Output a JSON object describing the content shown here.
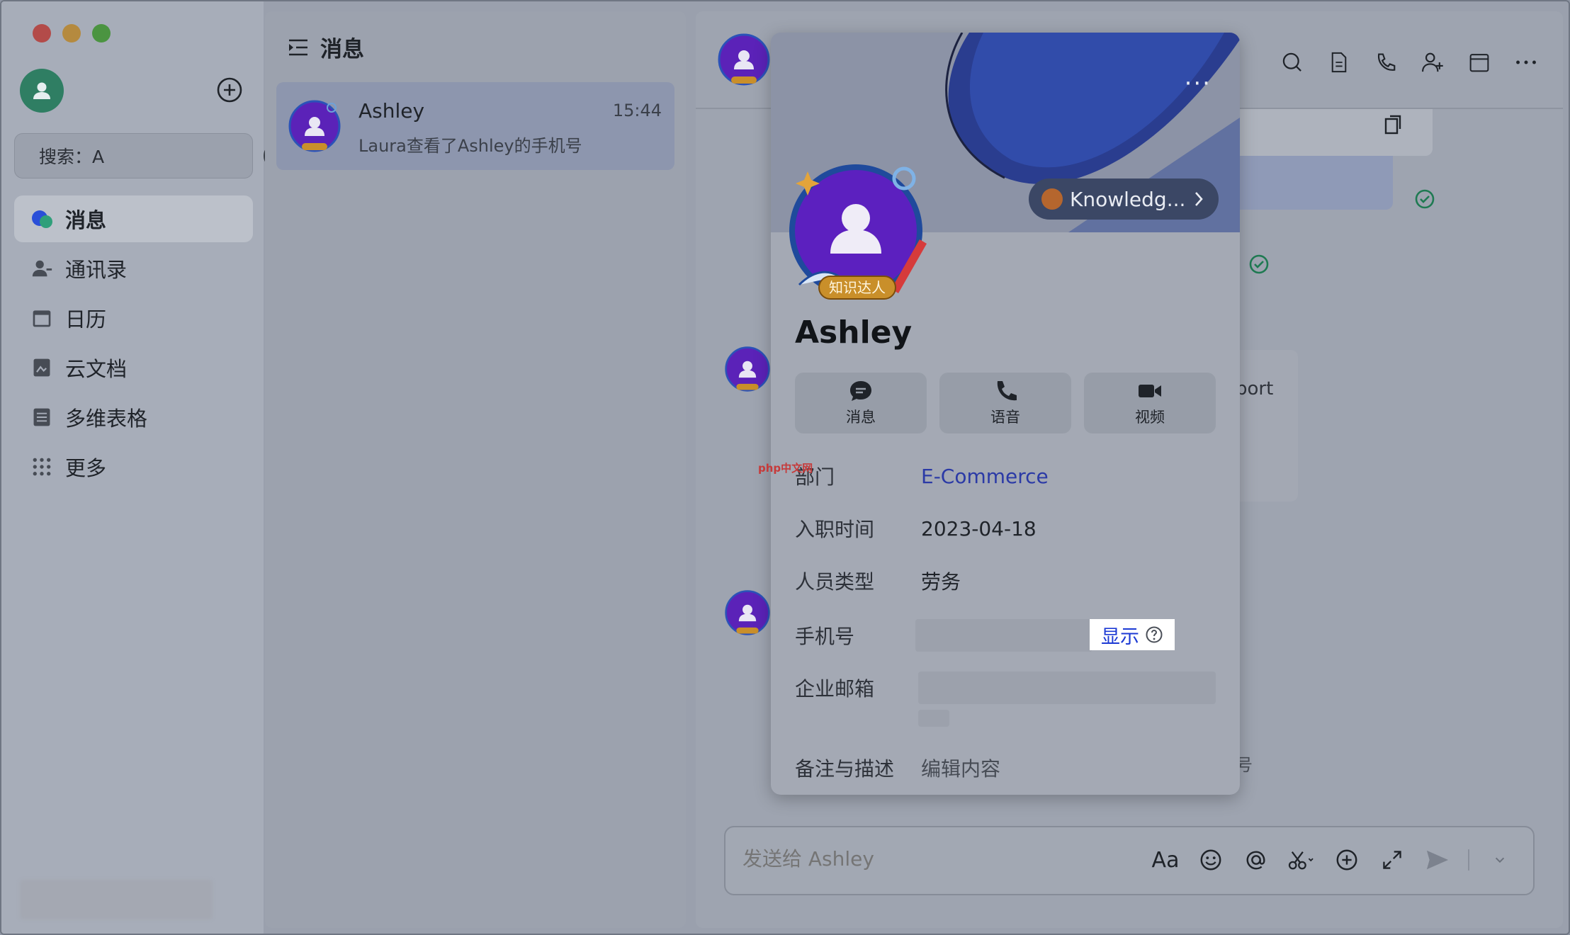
{
  "window": {
    "sidebar": {
      "search": {
        "value": "搜索：A"
      },
      "nav": [
        {
          "label": "消息",
          "icon": "messages-icon",
          "active": true
        },
        {
          "label": "通讯录",
          "icon": "contacts-icon"
        },
        {
          "label": "日历",
          "icon": "calendar-icon"
        },
        {
          "label": "云文档",
          "icon": "docs-icon"
        },
        {
          "label": "多维表格",
          "icon": "base-table-icon"
        },
        {
          "label": "更多",
          "icon": "more-apps-icon"
        }
      ]
    },
    "list": {
      "title": "消息",
      "conversations": [
        {
          "name": "Ashley",
          "time": "15:44",
          "preview": "Laura查看了Ashley的手机号"
        }
      ]
    },
    "chat": {
      "report_text": "eport",
      "stray_text": "号",
      "composer_placeholder": "发送给 Ashley",
      "font_button": "Aa"
    },
    "profile_card": {
      "badge_chip": "Knowledg...",
      "avatar_badge": "知识达人",
      "name": "Ashley",
      "actions": [
        {
          "label": "消息",
          "icon": "chat-bubble-icon"
        },
        {
          "label": "语音",
          "icon": "phone-icon"
        },
        {
          "label": "视频",
          "icon": "video-camera-icon"
        }
      ],
      "fields": {
        "department_label": "部门",
        "department_value": "E-Commerce",
        "hire_date_label": "入职时间",
        "hire_date_value": "2023-04-18",
        "staff_type_label": "人员类型",
        "staff_type_value": "劳务",
        "phone_label": "手机号",
        "phone_show": "显示",
        "email_label": "企业邮箱",
        "notes_label": "备注与描述",
        "notes_value": "编辑内容"
      }
    },
    "watermark": "php中文网"
  },
  "colors": {
    "accent_link": "#2b3aa6",
    "show_link": "#1c3ad4",
    "online_green": "#2f7e63",
    "check_green": "#1f7a52"
  }
}
